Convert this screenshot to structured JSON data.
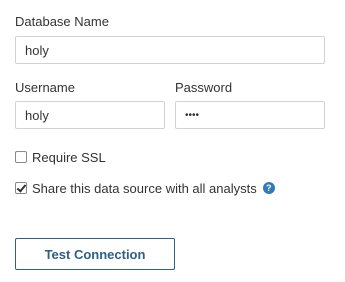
{
  "database": {
    "label": "Database Name",
    "value": "holy"
  },
  "username": {
    "label": "Username",
    "value": "holy"
  },
  "password": {
    "label": "Password",
    "value": "••••"
  },
  "require_ssl": {
    "label": "Require SSL",
    "checked": false
  },
  "share": {
    "label": "Share this data source with all analysts",
    "checked": true,
    "help_icon": "?"
  },
  "actions": {
    "test_label": "Test Connection"
  },
  "colors": {
    "button_border": "#2e5f88",
    "help_icon_bg": "#2f7ab8"
  },
  "icons": {
    "help": "question-circle-icon",
    "check": "checkmark-icon"
  }
}
